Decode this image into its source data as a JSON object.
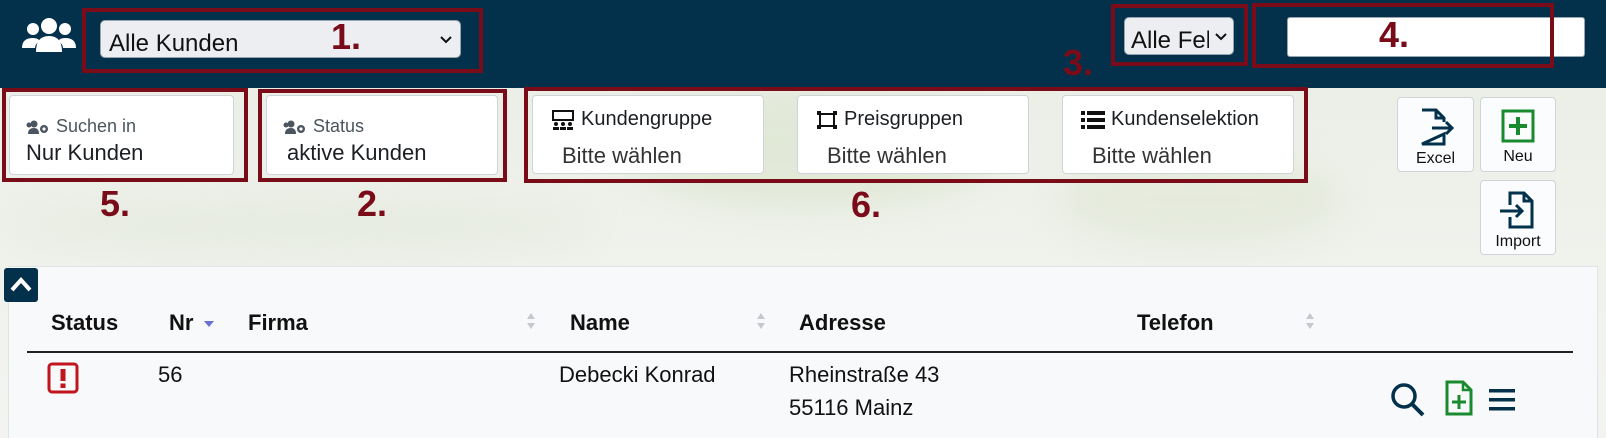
{
  "topbar": {
    "customer_filter": "Alle Kunden",
    "field_filter": "Alle Fel",
    "search_value": ""
  },
  "annotations": [
    "1.",
    "2.",
    "3.",
    "4.",
    "5.",
    "6."
  ],
  "filters": {
    "search_in": {
      "label": "Suchen in",
      "value": "Nur Kunden"
    },
    "status": {
      "label": "Status",
      "value": "aktive Kunden"
    },
    "kundengruppe": {
      "label": "Kundengruppe",
      "value": "Bitte wählen"
    },
    "preisgruppen": {
      "label": "Preisgruppen",
      "value": "Bitte wählen"
    },
    "kundenselektion": {
      "label": "Kundenselektion",
      "value": "Bitte wählen"
    }
  },
  "actions": {
    "excel": "Excel",
    "new": "Neu",
    "import": "Import"
  },
  "table": {
    "headers": {
      "status": "Status",
      "nr": "Nr",
      "firma": "Firma",
      "name": "Name",
      "adresse": "Adresse",
      "telefon": "Telefon"
    },
    "rows": [
      {
        "nr": "56",
        "firma": "",
        "name": "Debecki Konrad",
        "street": "Rheinstraße 43",
        "city": "55116 Mainz",
        "telefon": ""
      }
    ]
  },
  "colors": {
    "topbar": "#03314b",
    "annotation": "#7a0c1a",
    "status_alert": "#c0141e",
    "add_green": "#1a8a2e"
  }
}
